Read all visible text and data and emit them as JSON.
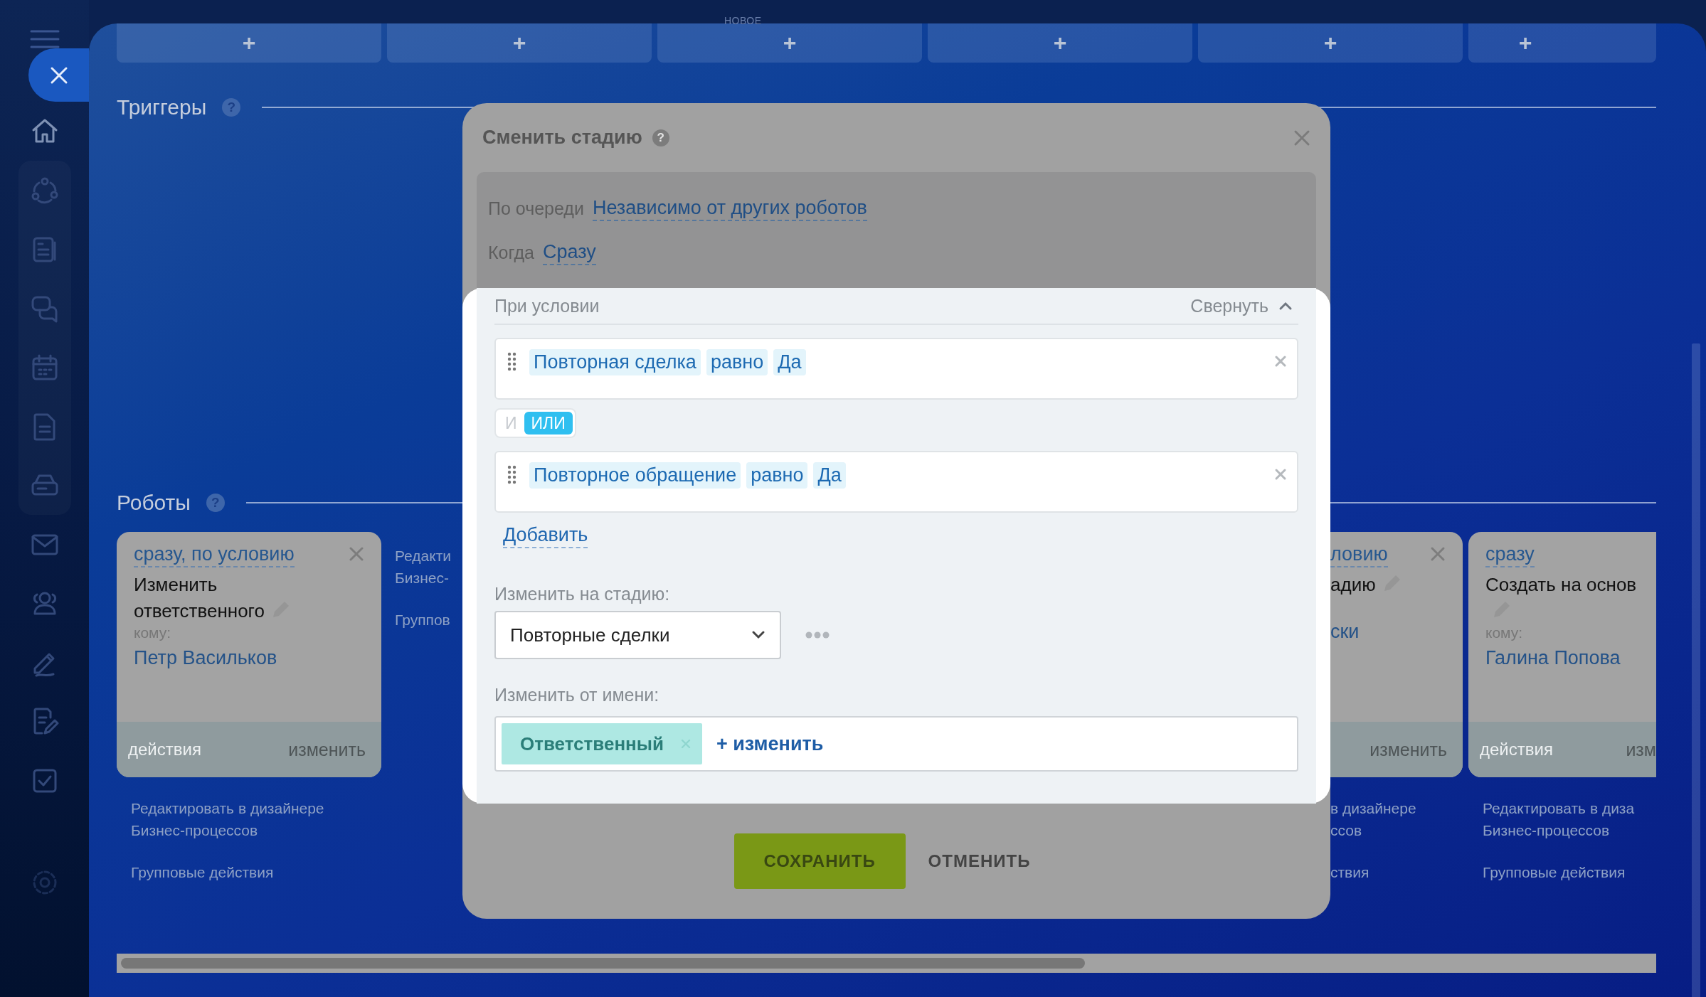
{
  "board": {
    "caption": "НОВОЕ",
    "stages": [
      {
        "label": "+"
      },
      {
        "label": "+"
      },
      {
        "label": "+"
      },
      {
        "label": "+"
      },
      {
        "label": "+"
      },
      {
        "label": "+"
      }
    ]
  },
  "triggers": {
    "title": "Триггеры",
    "help": "?"
  },
  "robots": {
    "title": "Роботы",
    "help": "?",
    "columns": [
      {
        "kind": "card",
        "card": {
          "when": "сразу, по условию",
          "action": "Изменить ответственного",
          "to_label": "кому:",
          "to": "Петр Васильков",
          "actions": "действия",
          "edit": "изменить",
          "closable": true
        },
        "links": [
          [
            "Редактировать в дизайнере",
            "Бизнес-процессов"
          ],
          [
            "Групповые действия"
          ]
        ]
      },
      {
        "kind": "links",
        "links": [
          [
            "Редакти",
            "Бизнес-"
          ],
          [
            "Группов"
          ]
        ]
      },
      {
        "kind": "covered",
        "card": {
          "when": "ловию",
          "action": "адию",
          "to": "ски",
          "edit": "изменить",
          "closable": true
        },
        "links": [
          [
            "в дизайнере",
            "ссов"
          ],
          [
            "ствия"
          ]
        ]
      },
      {
        "kind": "cut",
        "card": {
          "when": "сразу",
          "action": "Создать на основ",
          "to_label": "кому:",
          "to": "Галина Попова",
          "actions": "действия",
          "edit": "изм",
          "closable": false
        },
        "links": [
          [
            "Редактировать в диза",
            "Бизнес-процессов"
          ],
          [
            "Групповые действия"
          ]
        ]
      }
    ]
  },
  "modal": {
    "title": "Сменить стадию",
    "help": "?",
    "order": {
      "label": "По очереди",
      "value": "Независимо от других роботов"
    },
    "when": {
      "label": "Когда",
      "value": "Сразу"
    },
    "condition": {
      "title": "При условии",
      "collapse": "Свернуть",
      "expanded": true,
      "rules": [
        {
          "field": "Повторная сделка",
          "operator": "равно",
          "value": "Да"
        },
        {
          "field": "Повторное обращение",
          "operator": "равно",
          "value": "Да"
        }
      ],
      "logic": [
        {
          "label": "И",
          "selected": false
        },
        {
          "label": "ИЛИ",
          "selected": true
        }
      ],
      "add": "Добавить"
    },
    "stage": {
      "label": "Изменить на стадию:",
      "value": "Повторные сделки"
    },
    "author": {
      "label": "Изменить от имени:",
      "chips": [
        "Ответственный"
      ],
      "add": "+ изменить"
    },
    "buttons": [
      {
        "label": "СОХРАНИТЬ",
        "kind": "primary"
      },
      {
        "label": "ОТМЕНИТЬ",
        "kind": "link"
      }
    ]
  }
}
